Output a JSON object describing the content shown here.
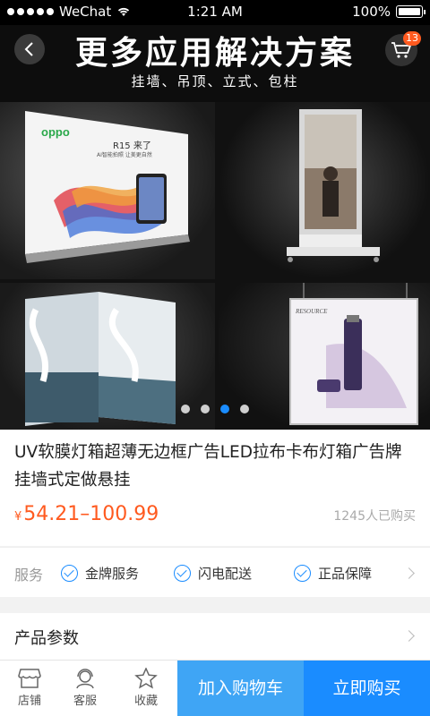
{
  "status_bar": {
    "carrier": "WeChat",
    "time": "1:21 AM",
    "battery": "100%"
  },
  "header": {
    "title": "更多应用解决方案",
    "subtitle": "挂墙、吊顶、立式、包柱",
    "cart_count": "13"
  },
  "carousel": {
    "images": [
      {
        "name": "oppo-lightbox",
        "brand": "oppo",
        "headline": "R15 来了",
        "subline": "AI智能拍照 让美更自然"
      },
      {
        "name": "standing-lightbox"
      },
      {
        "name": "column-lightbox",
        "letters": "S"
      },
      {
        "name": "hanging-lightbox",
        "brand": "RESOURCE"
      }
    ],
    "page_count": 4,
    "active_index": 2
  },
  "product": {
    "title": "UV软膜灯箱超薄无边框广告LED拉布卡布灯箱广告牌挂墙式定做悬挂",
    "currency": "¥",
    "price": "54.21–100.99",
    "sold": "1245人已购买"
  },
  "services": {
    "label": "服务",
    "items": [
      "金牌服务",
      "闪电配送",
      "正品保障"
    ]
  },
  "params": {
    "label": "产品参数"
  },
  "bottom_bar": {
    "tabs": [
      {
        "label": "店铺",
        "icon": "store-icon"
      },
      {
        "label": "客服",
        "icon": "customer-service-icon"
      },
      {
        "label": "收藏",
        "icon": "star-icon"
      }
    ],
    "add_to_cart": "加入购物车",
    "buy_now": "立即购买"
  },
  "colors": {
    "accent": "#1a8cff",
    "accent_light": "#3fa5f5",
    "price": "#ff5a1f",
    "header_bg": "#0d0d0d"
  }
}
